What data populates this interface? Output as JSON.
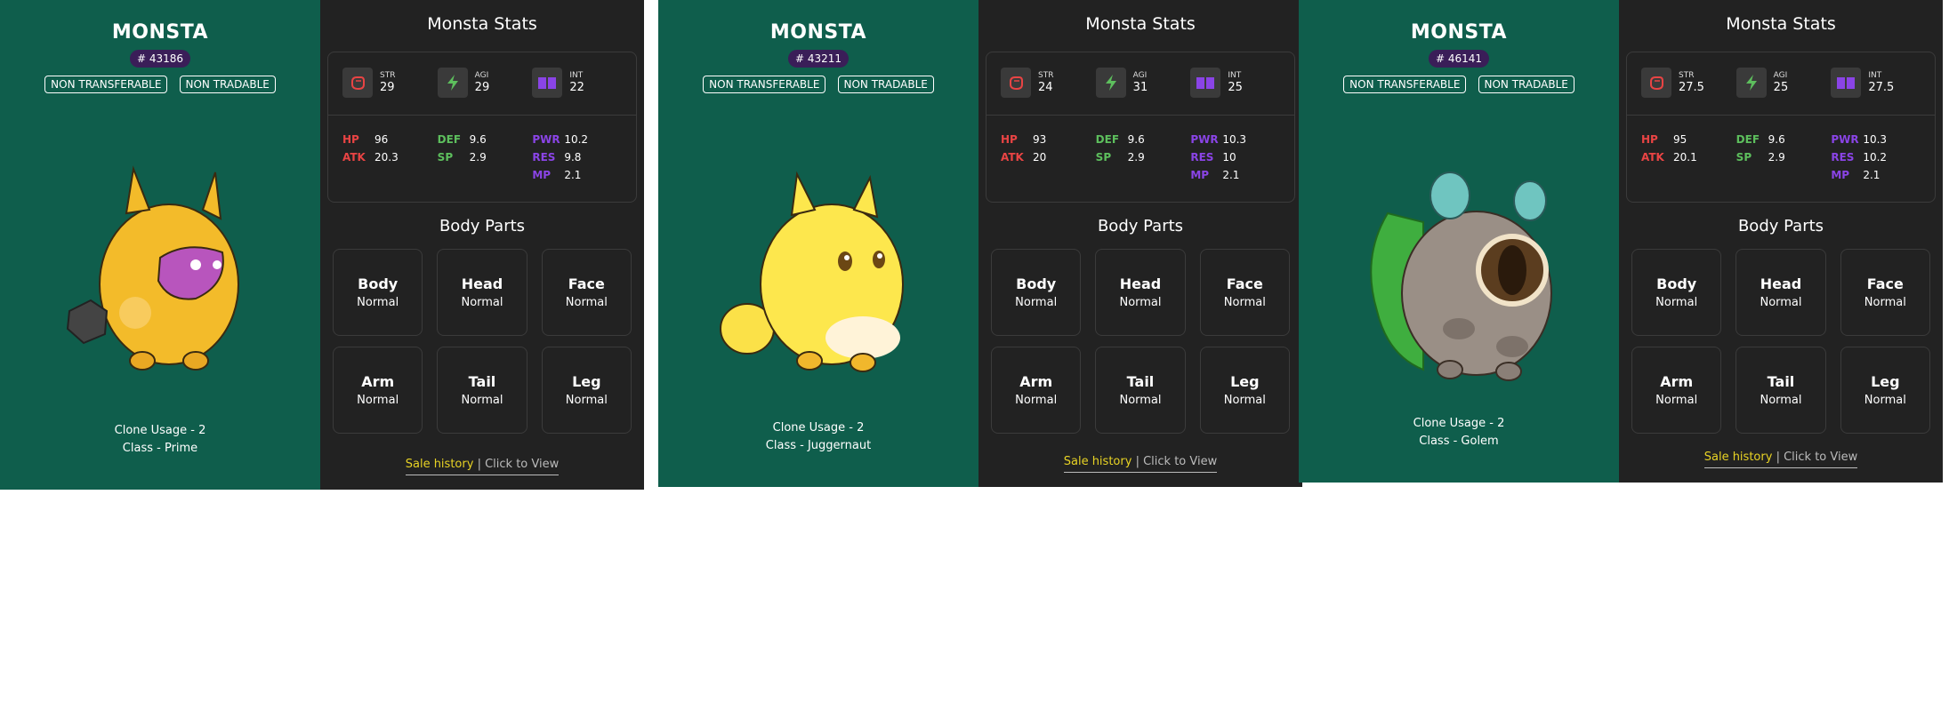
{
  "cards": [
    {
      "title": "MONSTA",
      "id": "# 43186",
      "tags": [
        "NON TRANSFERABLE",
        "NON TRADABLE"
      ],
      "clone_usage": "Clone Usage - 2",
      "class": "Class - Prime",
      "stats_title": "Monsta Stats",
      "primary": [
        {
          "icon": "fist-icon",
          "label": "STR",
          "value": "29"
        },
        {
          "icon": "lightning-icon",
          "label": "AGI",
          "value": "29"
        },
        {
          "icon": "book-icon",
          "label": "INT",
          "value": "22"
        }
      ],
      "secondary": [
        [
          {
            "key": "HP",
            "value": "96"
          },
          {
            "key": "ATK",
            "value": "20.3"
          }
        ],
        [
          {
            "key": "DEF",
            "value": "9.6"
          },
          {
            "key": "SP",
            "value": "2.9"
          }
        ],
        [
          {
            "key": "PWR",
            "value": "10.2"
          },
          {
            "key": "RES",
            "value": "9.8"
          },
          {
            "key": "MP",
            "value": "2.1"
          }
        ]
      ],
      "body_parts_title": "Body Parts",
      "parts": [
        {
          "name": "Body",
          "value": "Normal"
        },
        {
          "name": "Head",
          "value": "Normal"
        },
        {
          "name": "Face",
          "value": "Normal"
        },
        {
          "name": "Arm",
          "value": "Normal"
        },
        {
          "name": "Tail",
          "value": "Normal"
        },
        {
          "name": "Leg",
          "value": "Normal"
        }
      ],
      "sale_history": "Sale history",
      "separator": "|",
      "click_view": "Click to View"
    },
    {
      "title": "MONSTA",
      "id": "# 43211",
      "tags": [
        "NON TRANSFERABLE",
        "NON TRADABLE"
      ],
      "clone_usage": "Clone Usage - 2",
      "class": "Class - Juggernaut",
      "stats_title": "Monsta Stats",
      "primary": [
        {
          "icon": "fist-icon",
          "label": "STR",
          "value": "24"
        },
        {
          "icon": "lightning-icon",
          "label": "AGI",
          "value": "31"
        },
        {
          "icon": "book-icon",
          "label": "INT",
          "value": "25"
        }
      ],
      "secondary": [
        [
          {
            "key": "HP",
            "value": "93"
          },
          {
            "key": "ATK",
            "value": "20"
          }
        ],
        [
          {
            "key": "DEF",
            "value": "9.6"
          },
          {
            "key": "SP",
            "value": "2.9"
          }
        ],
        [
          {
            "key": "PWR",
            "value": "10.3"
          },
          {
            "key": "RES",
            "value": "10"
          },
          {
            "key": "MP",
            "value": "2.1"
          }
        ]
      ],
      "body_parts_title": "Body Parts",
      "parts": [
        {
          "name": "Body",
          "value": "Normal"
        },
        {
          "name": "Head",
          "value": "Normal"
        },
        {
          "name": "Face",
          "value": "Normal"
        },
        {
          "name": "Arm",
          "value": "Normal"
        },
        {
          "name": "Tail",
          "value": "Normal"
        },
        {
          "name": "Leg",
          "value": "Normal"
        }
      ],
      "sale_history": "Sale history",
      "separator": "|",
      "click_view": "Click to View"
    },
    {
      "title": "MONSTA",
      "id": "# 46141",
      "tags": [
        "NON TRANSFERABLE",
        "NON TRADABLE"
      ],
      "clone_usage": "Clone Usage - 2",
      "class": "Class - Golem",
      "stats_title": "Monsta Stats",
      "primary": [
        {
          "icon": "fist-icon",
          "label": "STR",
          "value": "27.5"
        },
        {
          "icon": "lightning-icon",
          "label": "AGI",
          "value": "25"
        },
        {
          "icon": "book-icon",
          "label": "INT",
          "value": "27.5"
        }
      ],
      "secondary": [
        [
          {
            "key": "HP",
            "value": "95"
          },
          {
            "key": "ATK",
            "value": "20.1"
          }
        ],
        [
          {
            "key": "DEF",
            "value": "9.6"
          },
          {
            "key": "SP",
            "value": "2.9"
          }
        ],
        [
          {
            "key": "PWR",
            "value": "10.3"
          },
          {
            "key": "RES",
            "value": "10.2"
          },
          {
            "key": "MP",
            "value": "2.1"
          }
        ]
      ],
      "body_parts_title": "Body Parts",
      "parts": [
        {
          "name": "Body",
          "value": "Normal"
        },
        {
          "name": "Head",
          "value": "Normal"
        },
        {
          "name": "Face",
          "value": "Normal"
        },
        {
          "name": "Arm",
          "value": "Normal"
        },
        {
          "name": "Tail",
          "value": "Normal"
        },
        {
          "name": "Leg",
          "value": "Normal"
        }
      ],
      "sale_history": "Sale history",
      "separator": "|",
      "click_view": "Click to View"
    }
  ]
}
